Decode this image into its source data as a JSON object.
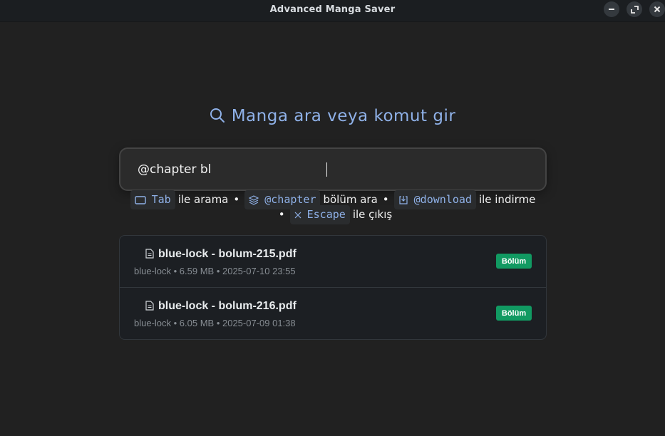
{
  "window": {
    "title": "Advanced Manga Saver",
    "controls": {
      "minimize": "minimize-icon",
      "maximize": "maximize-icon",
      "close": "close-icon"
    }
  },
  "heading": {
    "text": "Manga ara veya komut gir",
    "icon": "search-icon"
  },
  "search": {
    "value": "@chapter bl"
  },
  "hints": {
    "tab_key": "Tab",
    "tab_text": "ile arama",
    "chapter_key": "@chapter",
    "chapter_text": "bölüm ara",
    "download_key": "@download",
    "download_text": "ile indirme",
    "escape_key": "Escape",
    "escape_text": "ile çıkış",
    "separator": "•"
  },
  "results": [
    {
      "name": "blue-lock - bolum-215.pdf",
      "meta": "blue-lock • 6.59 MB • 2025-07-10 23:55",
      "badge": "Bölüm",
      "icon": "file-icon"
    },
    {
      "name": "blue-lock - bolum-216.pdf",
      "meta": "blue-lock • 6.05 MB • 2025-07-09 01:38",
      "badge": "Bölüm",
      "icon": "file-icon"
    }
  ],
  "colors": {
    "accent": "#8fb1e8",
    "badge": "#119a62",
    "background": "#212121"
  }
}
